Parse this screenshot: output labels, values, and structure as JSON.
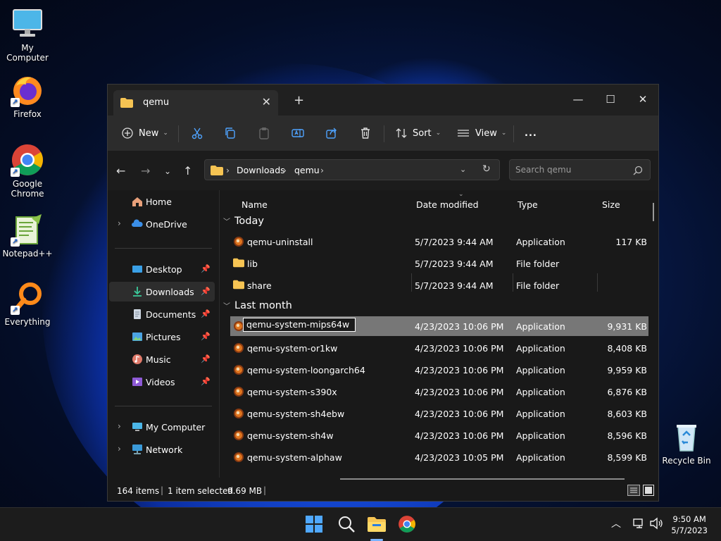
{
  "desktop": {
    "icons": [
      {
        "label": "My Computer",
        "icon": "monitor-icon"
      },
      {
        "label": "Firefox",
        "icon": "firefox-icon"
      },
      {
        "label": "Google Chrome",
        "icon": "chrome-icon"
      },
      {
        "label": "Notepad++",
        "icon": "notepad-plus-plus-icon"
      },
      {
        "label": "Everything",
        "icon": "everything-search-icon"
      },
      {
        "label": "Recycle Bin",
        "icon": "recycle-bin-icon"
      }
    ]
  },
  "window": {
    "tab_title": "qemu",
    "new_tab_label": "+",
    "toolbar": {
      "new_label": "New",
      "sort_label": "Sort",
      "view_label": "View",
      "more_label": "..."
    },
    "address": {
      "crumbs": [
        "Downloads",
        "qemu"
      ],
      "search_placeholder": "Search qemu"
    },
    "sidebar": {
      "items": [
        {
          "label": "Home",
          "icon": "home-icon"
        },
        {
          "label": "OneDrive",
          "icon": "cloud-icon"
        },
        {
          "label": "Desktop",
          "icon": "desktop-folder-icon"
        },
        {
          "label": "Downloads",
          "icon": "download-icon"
        },
        {
          "label": "Documents",
          "icon": "documents-icon"
        },
        {
          "label": "Pictures",
          "icon": "pictures-icon"
        },
        {
          "label": "Music",
          "icon": "music-icon"
        },
        {
          "label": "Videos",
          "icon": "videos-icon"
        },
        {
          "label": "My Computer",
          "icon": "computer-icon"
        },
        {
          "label": "Network",
          "icon": "network-icon"
        }
      ]
    },
    "columns": {
      "name": "Name",
      "date": "Date modified",
      "type": "Type",
      "size": "Size"
    },
    "groups": {
      "today": "Today",
      "last_month": "Last month"
    },
    "today_rows": [
      {
        "name": "qemu-uninstall",
        "date": "5/7/2023 9:44 AM",
        "type": "Application",
        "size": "117 KB",
        "icon": "app-icon"
      },
      {
        "name": "lib",
        "date": "5/7/2023 9:44 AM",
        "type": "File folder",
        "size": "",
        "icon": "folder-icon"
      },
      {
        "name": "share",
        "date": "5/7/2023 9:44 AM",
        "type": "File folder",
        "size": "",
        "icon": "folder-icon"
      }
    ],
    "month_rows": [
      {
        "name": "qemu-system-mips64w",
        "date": "4/23/2023 10:06 PM",
        "type": "Application",
        "size": "9,931 KB",
        "icon": "app-icon",
        "selected": true
      },
      {
        "name": "qemu-system-or1kw",
        "date": "4/23/2023 10:06 PM",
        "type": "Application",
        "size": "8,408 KB",
        "icon": "app-icon"
      },
      {
        "name": "qemu-system-loongarch64",
        "date": "4/23/2023 10:06 PM",
        "type": "Application",
        "size": "9,959 KB",
        "icon": "app-icon"
      },
      {
        "name": "qemu-system-s390x",
        "date": "4/23/2023 10:06 PM",
        "type": "Application",
        "size": "6,876 KB",
        "icon": "app-icon"
      },
      {
        "name": "qemu-system-sh4ebw",
        "date": "4/23/2023 10:06 PM",
        "type": "Application",
        "size": "8,603 KB",
        "icon": "app-icon"
      },
      {
        "name": "qemu-system-sh4w",
        "date": "4/23/2023 10:06 PM",
        "type": "Application",
        "size": "8,596 KB",
        "icon": "app-icon"
      },
      {
        "name": "qemu-system-alphaw",
        "date": "4/23/2023 10:05 PM",
        "type": "Application",
        "size": "8,599 KB",
        "icon": "app-icon"
      }
    ],
    "status": {
      "count": "164 items",
      "selected": "1 item selected",
      "size": "9.69 MB",
      "sep": "|",
      "sep2": "|"
    }
  },
  "taskbar": {
    "time": "9:50 AM",
    "date": "5/7/2023"
  },
  "colors": {
    "accent": "#4fa3ff",
    "folder": "#f6c453",
    "selection": "#777777"
  }
}
